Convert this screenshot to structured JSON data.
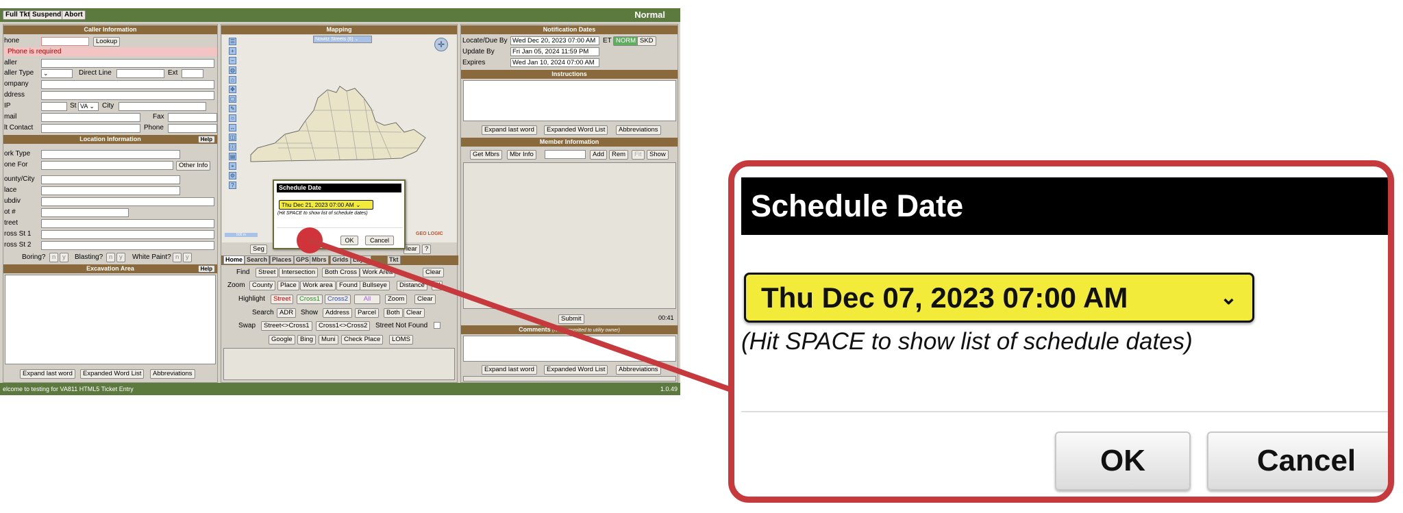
{
  "toolbar": {
    "full_tkt": "Full Tkt",
    "suspend": "Suspend",
    "abort": "Abort",
    "mode": "Normal"
  },
  "caller": {
    "header": "Caller Information",
    "phone": "hone",
    "lookup": "Lookup",
    "phone_error": "Phone is required",
    "caller": "aller",
    "caller_type": "aller Type",
    "direct_line": "Direct Line",
    "ext": "Ext",
    "company": "ompany",
    "address": "ddress",
    "zip": "IP",
    "st": "St",
    "state": "VA",
    "city": "City",
    "email": "mail",
    "fax": "Fax",
    "alt_contact": "lt Contact",
    "phone2": "Phone"
  },
  "location": {
    "header": "Location Information",
    "help": "Help",
    "work_type": "ork Type",
    "done_for": "one For",
    "other_info": "Other Info",
    "county": "ounty/City",
    "place": "lace",
    "subdiv": "ubdiv",
    "lot": "ot #",
    "street": "treet",
    "cross1": "ross St 1",
    "cross2": "ross St 2",
    "boring": "Boring?",
    "blasting": "Blasting?",
    "white_paint": "White Paint?",
    "n": "n",
    "y": "y"
  },
  "excavation": {
    "header": "Excavation Area",
    "help": "Help",
    "expand": "Expand last word",
    "expanded_list": "Expanded Word List",
    "abbreviations": "Abbreviations"
  },
  "mapping": {
    "header": "Mapping",
    "layer": "Nowitz Streets (6)",
    "scale": "500 m",
    "seg": "Seg",
    "clear": "lear",
    "q": "?",
    "geo": "GEO LOGIC"
  },
  "tabs": [
    "Home",
    "Search",
    "Places",
    "GPS",
    "Mbrs",
    "Grids",
    "Layer",
    "Tkt"
  ],
  "home": {
    "find": "Find",
    "street": "Street",
    "intersection": "Intersection",
    "both_cross": "Both Cross",
    "work_area": "Work Area",
    "clear": "Clear",
    "zoom": "Zoom",
    "county": "County",
    "place": "Place",
    "work_area2": "Work area",
    "found": "Found",
    "bullseye": "Bullseye",
    "distance": "Distance",
    "pl": "Pl",
    "highlight": "Highlight",
    "hl_street": "Street",
    "hl_cross1": "Cross1",
    "hl_cross2": "Cross2",
    "hl_all": "All",
    "hl_zoom": "Zoom",
    "hl_clear": "Clear",
    "search": "Search",
    "adr": "ADR",
    "show": "Show",
    "address": "Address",
    "parcel": "Parcel",
    "both": "Both",
    "s_clear": "Clear",
    "swap": "Swap",
    "street_cross1": "Street<>Cross1",
    "cross1_cross2": "Cross1<>Cross2",
    "street_not_found": "Street Not Found",
    "google": "Google",
    "bing": "Bing",
    "muni": "Muni",
    "check_place": "Check Place",
    "loms": "LOMS"
  },
  "notification": {
    "header": "Notification Dates",
    "locate_due": "Locate/Due By",
    "locate_due_val": "Wed Dec 20, 2023 07:00 AM",
    "et": "ET",
    "norm": "NORM",
    "skd": "SKD",
    "update_by": "Update By",
    "update_by_val": "Fri Jan 05, 2024 11:59 PM",
    "expires": "Expires",
    "expires_val": "Wed Jan 10, 2024 07:00 AM"
  },
  "instructions": {
    "header": "Instructions",
    "expand": "Expand last word",
    "expanded_list": "Expanded Word List",
    "abbreviations": "Abbreviations"
  },
  "member": {
    "header": "Member Information",
    "get_mbrs": "Get Mbrs",
    "mbr_info": "Mbr Info",
    "add": "Add",
    "rem": "Rem",
    "fit": "Fit",
    "show": "Show",
    "submit": "Submit",
    "timer": "00:41"
  },
  "comments": {
    "header": "Comments",
    "note": "(Not transmitted to utility owner)",
    "expand": "Expand last word",
    "expanded_list": "Expanded Word List",
    "abbreviations": "Abbreviations"
  },
  "status": {
    "welcome": "elcome to testing for VA811 HTML5 Ticket Entry",
    "version": "1.0.49"
  },
  "dialog_small": {
    "title": "Schedule Date",
    "date": "Thu Dec 21, 2023 07:00 AM",
    "hint": "(Hit SPACE to show list of schedule dates)",
    "ok": "OK",
    "cancel": "Cancel"
  },
  "dialog_zoom": {
    "title": "Schedule Date",
    "date": "Thu Dec 07, 2023 07:00 AM",
    "hint": "(Hit SPACE to show list of schedule dates)",
    "ok": "OK",
    "cancel": "Cancel"
  },
  "colors": {
    "accent_green": "#5c7a3e",
    "header_brown": "#8a6a3c",
    "callout_red": "#c63a3e",
    "select_yellow": "#f3eb3a"
  }
}
